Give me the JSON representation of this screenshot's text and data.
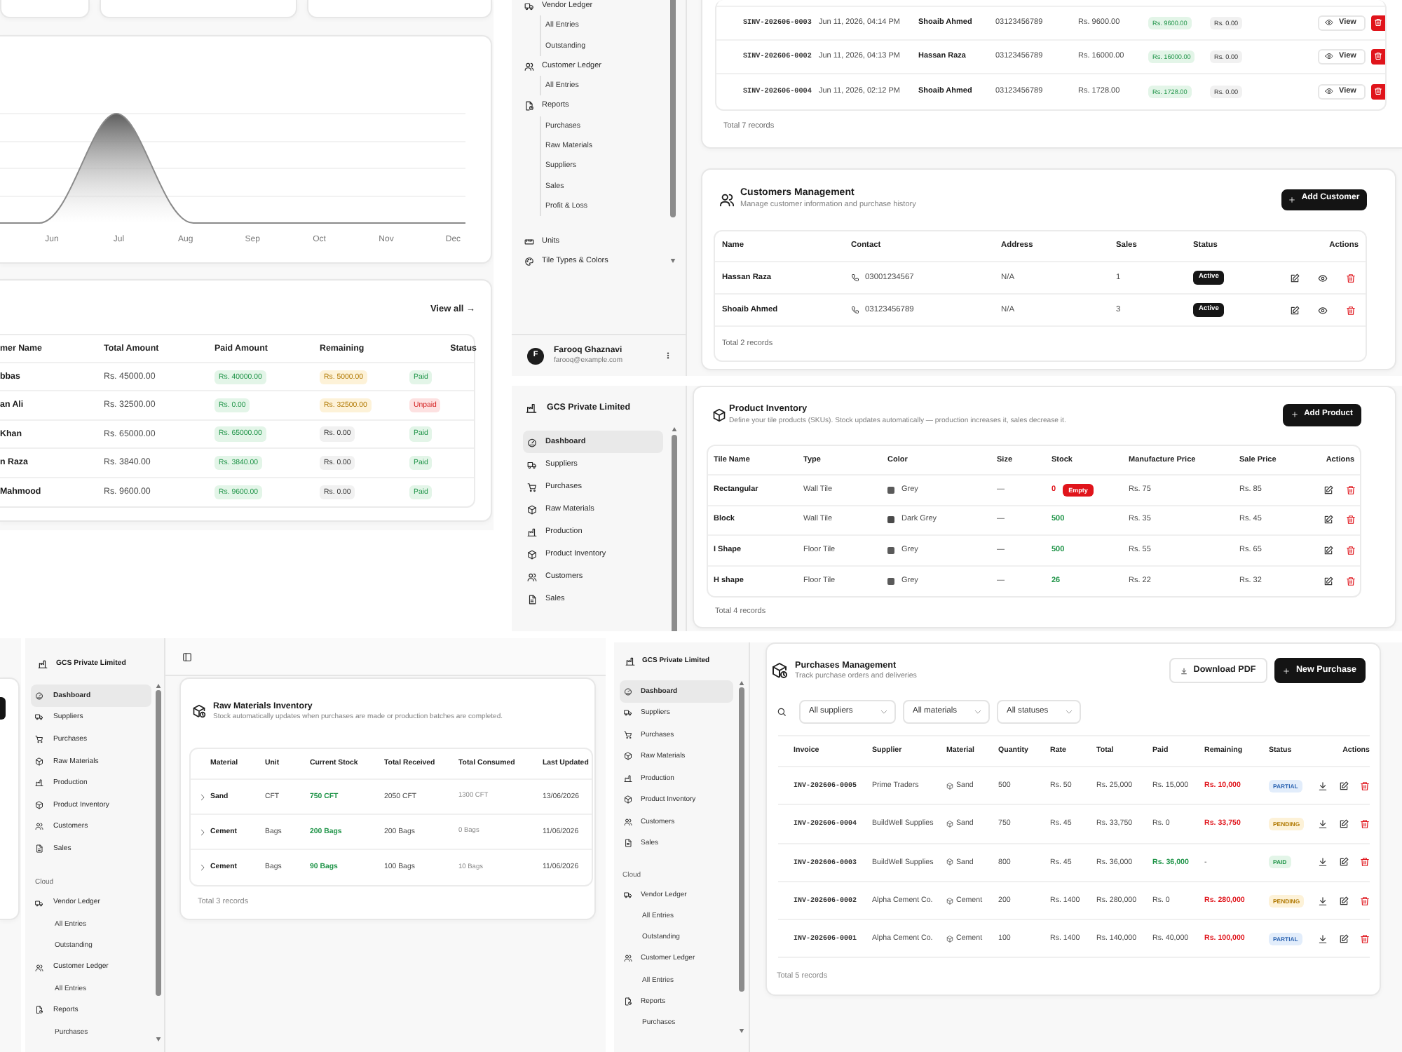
{
  "dashboard": {
    "chart": {
      "x_labels": [
        "Jun",
        "Jul",
        "Aug",
        "Sep",
        "Oct",
        "Nov",
        "Dec"
      ]
    },
    "recent_sales": {
      "link": "View all →",
      "columns": [
        "mer Name",
        "Total Amount",
        "Paid Amount",
        "Remaining",
        "Status"
      ],
      "rows": [
        {
          "customer": "bbas",
          "total": "Rs. 45000.00",
          "paid": "Rs. 40000.00",
          "remaining": {
            "text": "Rs. 5000.00",
            "kind": "due"
          },
          "status": {
            "label": "Paid",
            "kind": "paid"
          }
        },
        {
          "customer": "an Ali",
          "total": "Rs. 32500.00",
          "paid": "Rs. 0.00",
          "remaining": {
            "text": "Rs. 32500.00",
            "kind": "due"
          },
          "status": {
            "label": "Unpaid",
            "kind": "unpaid"
          }
        },
        {
          "customer": "Khan",
          "total": "Rs. 65000.00",
          "paid": "Rs. 65000.00",
          "remaining": {
            "text": "Rs. 0.00",
            "kind": "clear"
          },
          "status": {
            "label": "Paid",
            "kind": "paid"
          }
        },
        {
          "customer": "n Raza",
          "total": "Rs. 3840.00",
          "paid": "Rs. 3840.00",
          "remaining": {
            "text": "Rs. 0.00",
            "kind": "clear"
          },
          "status": {
            "label": "Paid",
            "kind": "paid"
          }
        },
        {
          "customer": "Mahmood",
          "total": "Rs. 9600.00",
          "paid": "Rs. 9600.00",
          "remaining": {
            "text": "Rs. 0.00",
            "kind": "clear"
          },
          "status": {
            "label": "Paid",
            "kind": "paid"
          }
        }
      ]
    }
  },
  "sidebar_top": {
    "sections": [
      {
        "items": [
          {
            "label": "Vendor Ledger",
            "kind": "truck",
            "selected": false,
            "children": [
              {
                "label": "All Entries",
                "selected": false
              },
              {
                "label": "Outstanding",
                "selected": false
              }
            ]
          },
          {
            "label": "Customer Ledger",
            "kind": "users",
            "selected": false,
            "children": [
              {
                "label": "All Entries",
                "selected": false
              }
            ]
          },
          {
            "label": "Reports",
            "kind": "report",
            "selected": false,
            "children": [
              {
                "label": "Purchases",
                "selected": false
              },
              {
                "label": "Raw Materials",
                "selected": false
              },
              {
                "label": "Suppliers",
                "selected": false
              },
              {
                "label": "Sales",
                "selected": false
              },
              {
                "label": "Profit & Loss",
                "selected": false
              }
            ]
          }
        ]
      },
      {
        "items": [
          {
            "label": "Units",
            "kind": "ruler",
            "selected": false
          },
          {
            "label": "Tile Types & Colors",
            "kind": "palette",
            "selected": false
          }
        ]
      }
    ],
    "user": {
      "initial": "F",
      "name": "Farooq Ghaznavi",
      "email": "farooq@example.com"
    }
  },
  "sales": {
    "rows": [
      {
        "invoice": "SINV-202606-0003",
        "date": "Jun 11, 2026, 04:14 PM",
        "customer": "Shoaib Ahmed",
        "phone": "03123456789",
        "amount": "Rs. 9600.00",
        "paid": "Rs. 9600.00",
        "remaining": {
          "text": "Rs. 0.00",
          "kind": "clear"
        },
        "action": "View"
      },
      {
        "invoice": "SINV-202606-0002",
        "date": "Jun 11, 2026, 04:13 PM",
        "customer": "Hassan Raza",
        "phone": "03123456789",
        "amount": "Rs. 16000.00",
        "paid": "Rs. 16000.00",
        "remaining": {
          "text": "Rs. 0.00",
          "kind": "clear"
        },
        "action": "View"
      },
      {
        "invoice": "SINV-202606-0004",
        "date": "Jun 11, 2026, 02:12 PM",
        "customer": "Shoaib Ahmed",
        "phone": "03123456789",
        "amount": "Rs. 1728.00",
        "paid": "Rs. 1728.00",
        "remaining": {
          "text": "Rs. 0.00",
          "kind": "clear"
        },
        "action": "View"
      }
    ],
    "footer": "Total 7 records"
  },
  "customers": {
    "title": "Customers Management",
    "subtitle": "Manage customer information and purchase history",
    "add_button": "Add Customer",
    "columns": [
      "Name",
      "Contact",
      "Address",
      "Sales",
      "Status",
      "Actions"
    ],
    "rows": [
      {
        "name": "Hassan Raza",
        "contact": "03001234567",
        "address": "N/A",
        "sales": "1",
        "status": "Active"
      },
      {
        "name": "Shoaib Ahmed",
        "contact": "03123456789",
        "address": "N/A",
        "sales": "3",
        "status": "Active"
      }
    ],
    "footer": "Total 2 records"
  },
  "sidebar_middle": {
    "brand": "GCS Private Limited",
    "sections": [
      {
        "items": [
          {
            "label": "Dashboard",
            "kind": "gauge",
            "selected": true
          },
          {
            "label": "Suppliers",
            "kind": "truck",
            "selected": false
          },
          {
            "label": "Purchases",
            "kind": "cart",
            "selected": false
          },
          {
            "label": "Raw Materials",
            "kind": "package",
            "selected": false
          },
          {
            "label": "Production",
            "kind": "factory",
            "selected": false
          },
          {
            "label": "Product Inventory",
            "kind": "package",
            "selected": false
          },
          {
            "label": "Customers",
            "kind": "users",
            "selected": false
          },
          {
            "label": "Sales",
            "kind": "file",
            "selected": false
          }
        ]
      }
    ]
  },
  "products": {
    "title": "Product Inventory",
    "subtitle": "Define your tile products (SKUs). Stock updates automatically — production increases it, sales decrease it.",
    "add_button": "Add Product",
    "columns": [
      "Tile Name",
      "Type",
      "Color",
      "Size",
      "Stock",
      "Manufacture Price",
      "Sale Price",
      "Actions"
    ],
    "rows": [
      {
        "name": "Rectangular",
        "type": "Wall Tile",
        "color_name": "Grey",
        "color": "#5a5a5a",
        "size": "—",
        "stock": {
          "text": "0",
          "kind": "empty",
          "badge": "Empty"
        },
        "cost": "Rs. 75",
        "price": "Rs. 85"
      },
      {
        "name": "Block",
        "type": "Wall Tile",
        "color_name": "Dark Grey",
        "color": "#4a4a4a",
        "size": "—",
        "stock": {
          "text": "500",
          "kind": "in_stock"
        },
        "cost": "Rs. 35",
        "price": "Rs. 45"
      },
      {
        "name": "I Shape",
        "type": "Floor Tile",
        "color_name": "Grey",
        "color": "#5a5a5a",
        "size": "—",
        "stock": {
          "text": "500",
          "kind": "in_stock"
        },
        "cost": "Rs. 55",
        "price": "Rs. 65"
      },
      {
        "name": "H shape",
        "type": "Floor Tile",
        "color_name": "Grey",
        "color": "#5a5a5a",
        "size": "—",
        "stock": {
          "text": "26",
          "kind": "in_stock"
        },
        "cost": "Rs. 22",
        "price": "Rs. 32"
      }
    ],
    "footer": "Total 4 records"
  },
  "sidebar_bottom_left": {
    "brand": "GCS Private Limited",
    "sections": [
      {
        "items": [
          {
            "label": "Dashboard",
            "kind": "gauge",
            "selected": true
          },
          {
            "label": "Suppliers",
            "kind": "truck",
            "selected": false
          },
          {
            "label": "Purchases",
            "kind": "cart",
            "selected": false
          },
          {
            "label": "Raw Materials",
            "kind": "package",
            "selected": false
          },
          {
            "label": "Production",
            "kind": "factory",
            "selected": false
          },
          {
            "label": "Product Inventory",
            "kind": "package",
            "selected": false
          },
          {
            "label": "Customers",
            "kind": "users",
            "selected": false
          },
          {
            "label": "Sales",
            "kind": "file",
            "selected": false
          }
        ]
      },
      {
        "heading": "Cloud",
        "items": [
          {
            "label": "Vendor Ledger",
            "kind": "truck",
            "selected": false,
            "children": [
              {
                "label": "All Entries",
                "selected": false
              },
              {
                "label": "Outstanding",
                "selected": false
              }
            ]
          },
          {
            "label": "Customer Ledger",
            "kind": "users",
            "selected": false,
            "children": [
              {
                "label": "All Entries",
                "selected": false
              }
            ]
          },
          {
            "label": "Reports",
            "kind": "report",
            "selected": false,
            "children": [
              {
                "label": "Purchases",
                "selected": false
              }
            ]
          }
        ]
      }
    ]
  },
  "raw_materials": {
    "title": "Raw Materials Inventory",
    "subtitle": "Stock automatically updates when purchases are made or production batches are completed.",
    "columns": [
      "Material",
      "Unit",
      "Current Stock",
      "Total Received",
      "Total Consumed",
      "Last Updated"
    ],
    "rows": [
      {
        "expanded": false,
        "material": "Sand",
        "unit": "CFT",
        "current_stock": "750 CFT",
        "received": "2050 CFT",
        "consumed": "1300 CFT",
        "updated": "13/06/2026"
      },
      {
        "expanded": false,
        "material": "Cement",
        "unit": "Bags",
        "current_stock": "200 Bags",
        "received": "200 Bags",
        "consumed": "0 Bags",
        "updated": "11/06/2026"
      },
      {
        "expanded": false,
        "material": "Cement",
        "unit": "Bags",
        "current_stock": "90 Bags",
        "received": "100 Bags",
        "consumed": "10 Bags",
        "updated": "11/06/2026"
      }
    ],
    "footer": "Total 3 records"
  },
  "sidebar_bottom_right": {
    "brand": "GCS Private Limited",
    "sections": [
      {
        "items": [
          {
            "label": "Dashboard",
            "kind": "gauge",
            "selected": true
          },
          {
            "label": "Suppliers",
            "kind": "truck",
            "selected": false
          },
          {
            "label": "Purchases",
            "kind": "cart",
            "selected": false
          },
          {
            "label": "Raw Materials",
            "kind": "package",
            "selected": false
          },
          {
            "label": "Production",
            "kind": "factory",
            "selected": false
          },
          {
            "label": "Product Inventory",
            "kind": "package",
            "selected": false
          },
          {
            "label": "Customers",
            "kind": "users",
            "selected": false
          },
          {
            "label": "Sales",
            "kind": "file",
            "selected": false
          }
        ]
      },
      {
        "heading": "Cloud",
        "items": [
          {
            "label": "Vendor Ledger",
            "kind": "truck",
            "selected": false,
            "children": [
              {
                "label": "All Entries",
                "selected": false
              },
              {
                "label": "Outstanding",
                "selected": false
              }
            ]
          },
          {
            "label": "Customer Ledger",
            "kind": "users",
            "selected": false,
            "children": [
              {
                "label": "All Entries",
                "selected": false
              }
            ]
          },
          {
            "label": "Reports",
            "kind": "report",
            "selected": false,
            "children": [
              {
                "label": "Purchases",
                "selected": false
              }
            ]
          }
        ]
      }
    ]
  },
  "purchases": {
    "title": "Purchases Management",
    "subtitle": "Track purchase orders and deliveries",
    "download_button": "Download PDF",
    "add_button": "New Purchase",
    "filters": [
      {
        "value": "All suppliers"
      },
      {
        "value": "All materials"
      },
      {
        "value": "All statuses"
      }
    ],
    "columns": [
      "Invoice",
      "Supplier",
      "Material",
      "Quantity",
      "Rate",
      "Total",
      "Paid",
      "Remaining",
      "Status",
      "Actions"
    ],
    "rows": [
      {
        "invoice": "INV-202606-0005",
        "supplier": "Prime Traders",
        "material": "Sand",
        "quantity": "500",
        "rate": "Rs. 50",
        "total": "Rs. 25,000",
        "paid": "Rs. 15,000",
        "remaining": "Rs. 10,000",
        "status": {
          "label": "PARTIAL",
          "kind": "partial"
        }
      },
      {
        "invoice": "INV-202606-0004",
        "supplier": "BuildWell Supplies",
        "material": "Sand",
        "quantity": "750",
        "rate": "Rs. 45",
        "total": "Rs. 33,750",
        "paid": "Rs. 0",
        "remaining": "Rs. 33,750",
        "status": {
          "label": "PENDING",
          "kind": "pending"
        }
      },
      {
        "invoice": "INV-202606-0003",
        "supplier": "BuildWell Supplies",
        "material": "Sand",
        "quantity": "800",
        "rate": "Rs. 45",
        "total": "Rs. 36,000",
        "paid": "Rs. 36,000",
        "remaining": "-",
        "status": {
          "label": "PAID",
          "kind": "paid"
        }
      },
      {
        "invoice": "INV-202606-0002",
        "supplier": "Alpha Cement Co.",
        "material": "Cement",
        "quantity": "200",
        "rate": "Rs. 1400",
        "total": "Rs. 280,000",
        "paid": "Rs. 0",
        "remaining": "Rs. 280,000",
        "status": {
          "label": "PENDING",
          "kind": "pending"
        }
      },
      {
        "invoice": "INV-202606-0001",
        "supplier": "Alpha Cement Co.",
        "material": "Cement",
        "quantity": "100",
        "rate": "Rs. 1400",
        "total": "Rs. 140,000",
        "paid": "Rs. 40,000",
        "remaining": "Rs. 100,000",
        "status": {
          "label": "PARTIAL",
          "kind": "partial"
        }
      }
    ],
    "footer": "Total 5 records"
  }
}
